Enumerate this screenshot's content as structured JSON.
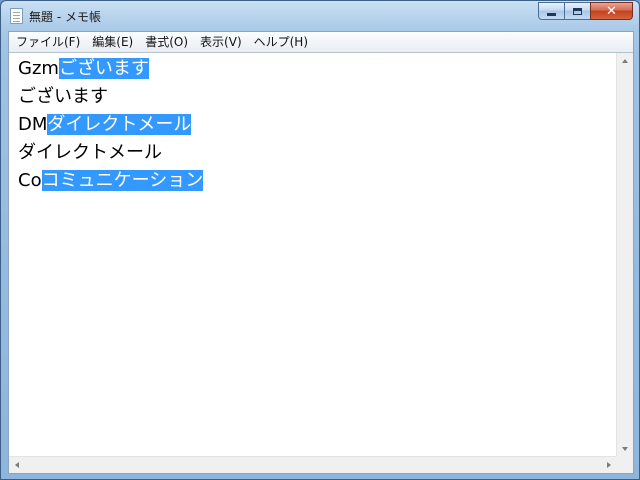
{
  "window": {
    "title": "無題 - メモ帳",
    "close_glyph": "✕"
  },
  "menu": {
    "items": [
      {
        "label": "ファイル(F)"
      },
      {
        "label": "編集(E)"
      },
      {
        "label": "書式(O)"
      },
      {
        "label": "表示(V)"
      },
      {
        "label": "ヘルプ(H)"
      }
    ]
  },
  "editor": {
    "lines": [
      {
        "plain": "Gzm",
        "selected": "ございます"
      },
      {
        "plain": "ございます",
        "selected": ""
      },
      {
        "plain": "DM",
        "selected": "ダイレクトメール"
      },
      {
        "plain": "ダイレクトメール",
        "selected": ""
      },
      {
        "plain": "Co",
        "selected": "コミュニケーション"
      }
    ]
  },
  "colors": {
    "selection": "#3399ff",
    "selection_text": "#ffffff",
    "close_button": "#c2411f"
  }
}
